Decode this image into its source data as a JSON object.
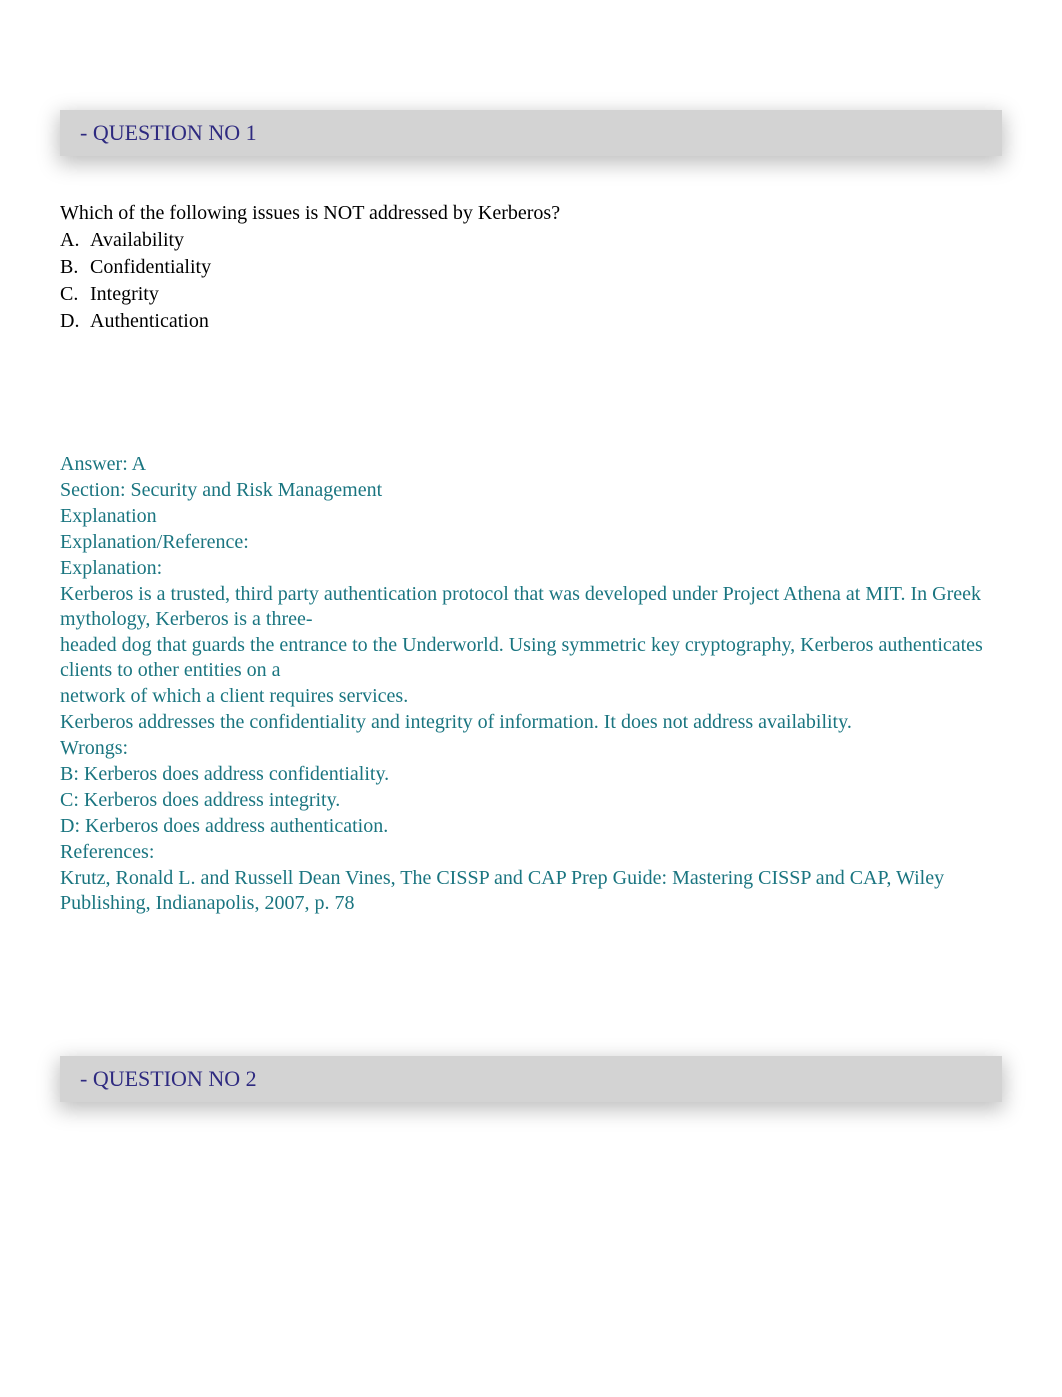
{
  "question1": {
    "header_prefix": "- QUESTION NO ",
    "number": "1",
    "prompt": "Which of the following issues is NOT addressed by Kerberos?",
    "options": {
      "A": {
        "letter": "A.",
        "text": "Availability"
      },
      "B": {
        "letter": "B.",
        "text": "Confidentiality"
      },
      "C": {
        "letter": "C.",
        "text": "Integrity"
      },
      "D": {
        "letter": "D.",
        "text": "Authentication"
      }
    },
    "answer": {
      "answer_line": "Answer: A",
      "section_line": "Section: Security and Risk Management",
      "explanation_heading": "Explanation",
      "explanation_reference_heading": "Explanation/Reference:",
      "explanation_label": "Explanation:",
      "body1": "Kerberos is a trusted, third party authentication protocol that was developed under Project Athena at MIT. In Greek mythology, Kerberos is a three-",
      "body2": "headed dog that guards the entrance to the Underworld. Using symmetric key cryptography, Kerberos authenticates clients to other entities on a",
      "body3": "network of which a client requires services.",
      "body4": "Kerberos addresses the confidentiality and integrity of information. It does not address availability.",
      "wrongs_label": "Wrongs:",
      "wrong_b": "B: Kerberos does address confidentiality.",
      "wrong_c": "C: Kerberos does address integrity.",
      "wrong_d": "D: Kerberos does address authentication.",
      "references_label": "References:",
      "reference_text": "Krutz, Ronald L. and Russell Dean Vines, The CISSP and CAP Prep Guide: Mastering CISSP and CAP, Wiley Publishing, Indianapolis, 2007, p. 78"
    }
  },
  "question2": {
    "header_prefix": "- QUESTION NO ",
    "number": "2"
  }
}
